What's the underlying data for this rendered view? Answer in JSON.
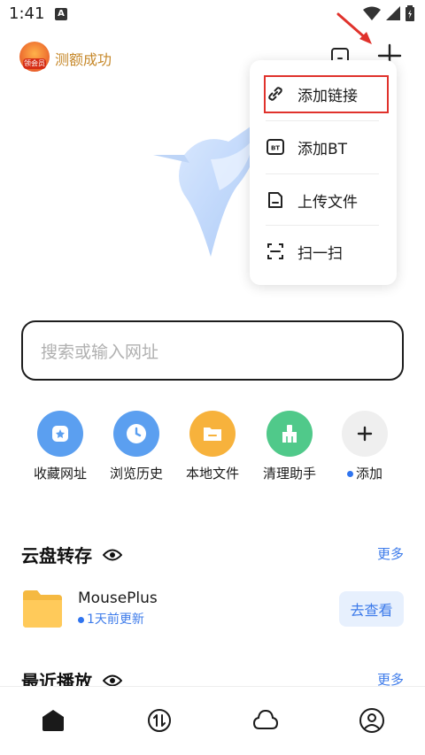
{
  "status_bar": {
    "time": "1:41",
    "notif_letter": "A"
  },
  "header": {
    "vip_badge_text": "领会员",
    "title": "测额成功"
  },
  "menu": {
    "items": [
      {
        "label": "添加链接",
        "icon": "link-icon"
      },
      {
        "label": "添加BT",
        "icon": "bt-icon",
        "icon_text": "BT"
      },
      {
        "label": "上传文件",
        "icon": "upload-file-icon"
      },
      {
        "label": "扫一扫",
        "icon": "scan-icon"
      }
    ]
  },
  "search": {
    "placeholder": "搜索或输入网址"
  },
  "quick_tiles": [
    {
      "label": "收藏网址",
      "icon": "star-bookmark-icon",
      "color": "#5b9ff0"
    },
    {
      "label": "浏览历史",
      "icon": "clock-icon",
      "color": "#5b9ff0"
    },
    {
      "label": "本地文件",
      "icon": "folder-icon",
      "color": "#f7b23c"
    },
    {
      "label": "清理助手",
      "icon": "broom-icon",
      "color": "#50c98a"
    },
    {
      "label": "添加",
      "icon": "plus-icon",
      "color": "#eeeeee"
    }
  ],
  "cloud_section": {
    "title": "云盘转存",
    "more": "更多"
  },
  "cloud_item": {
    "name": "MousePlus",
    "sub": "1天前更新",
    "action": "去查看"
  },
  "recent_section": {
    "title": "最近播放",
    "more": "更多"
  },
  "bottom_nav": [
    "home-icon",
    "transfer-icon",
    "cloud-icon",
    "profile-icon"
  ],
  "colors": {
    "accent": "#3d7bea",
    "annotation_red": "#e0322c"
  }
}
